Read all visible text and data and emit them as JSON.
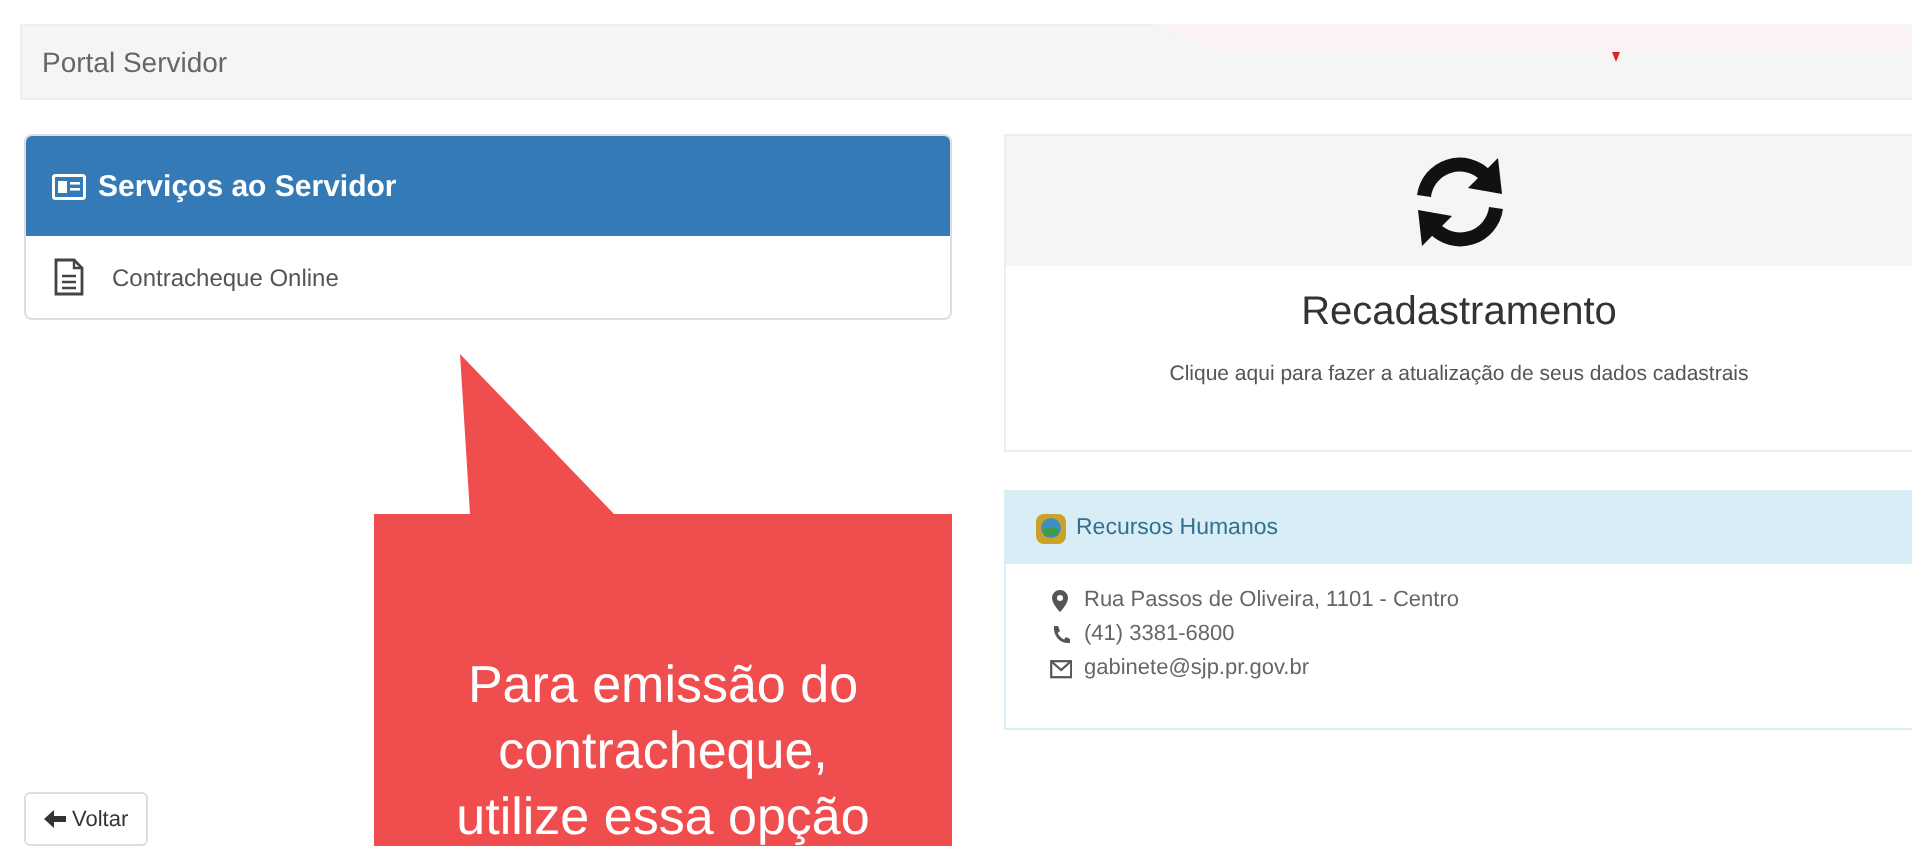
{
  "breadcrumb": "Portal Servidor",
  "services_panel": {
    "title": "Serviços ao Servidor",
    "items": [
      {
        "label": "Contracheque Online"
      }
    ]
  },
  "recadastramento": {
    "title": "Recadastramento",
    "description": "Clique aqui para fazer a atualização de seus dados cadastrais"
  },
  "contact_panel": {
    "title": "Recursos Humanos",
    "lines": [
      {
        "kind": "address",
        "text": "Rua Passos de Oliveira, 1101 - Centro"
      },
      {
        "kind": "phone",
        "text": "(41) 3381-6800"
      },
      {
        "kind": "email",
        "text": "gabinete@sjp.pr.gov.br"
      }
    ]
  },
  "back_button": "Voltar",
  "callout": "Para emissão do\ncontracheque,\nutilize essa opção"
}
